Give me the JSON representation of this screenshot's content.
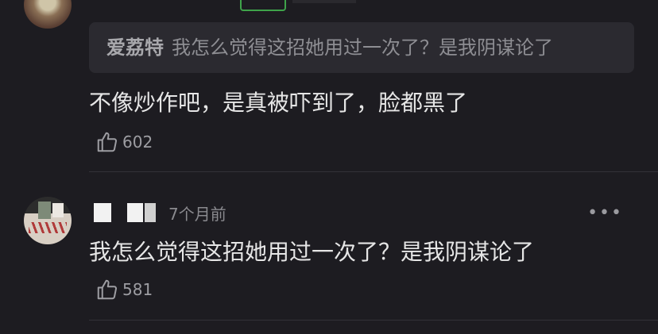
{
  "comments": [
    {
      "reply_to": {
        "user": "爱荔特",
        "text": "我怎么觉得这招她用过一次了？是我阴谋论了"
      },
      "text": "不像炒作吧，是真被吓到了，脸都黑了",
      "likes": "602"
    },
    {
      "time": "7个月前",
      "more_label": "•••",
      "text": "我怎么觉得这招她用过一次了？是我阴谋论了",
      "likes": "581"
    }
  ],
  "icons": {
    "like": "thumbs-up-icon",
    "more": "more-options-icon"
  },
  "colors": {
    "background": "#1d1c21",
    "quote_background": "#2b2a30",
    "badge_green": "#3fa34a"
  }
}
